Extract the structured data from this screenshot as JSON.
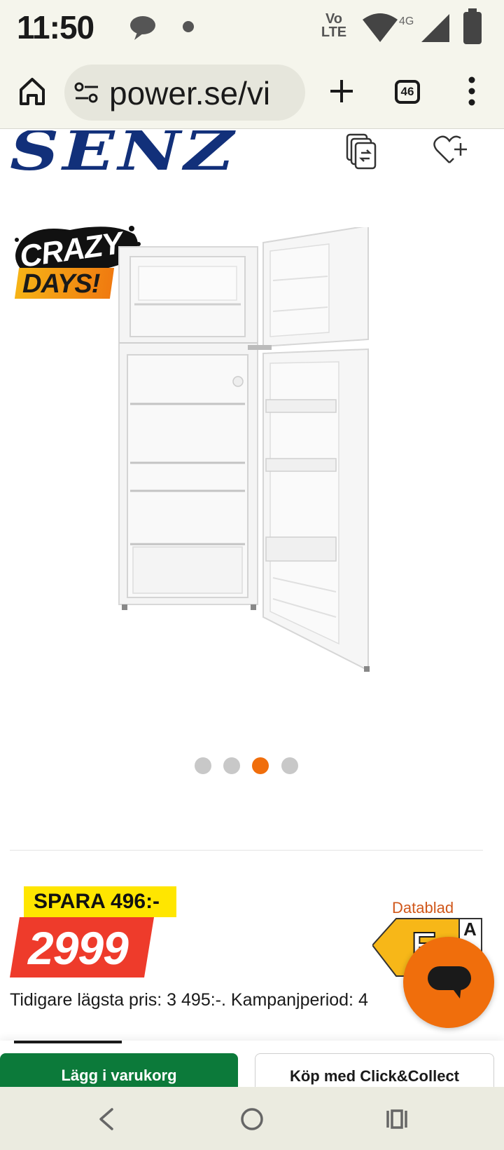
{
  "status_bar": {
    "time": "11:50",
    "network_label_top": "Vo",
    "network_label_bottom": "LTE",
    "signal_type": "4G",
    "icons": [
      "chat-bubble-icon",
      "dot-icon",
      "volte-icon",
      "wifi-icon",
      "signal-icon",
      "battery-icon"
    ]
  },
  "browser": {
    "url": "power.se/vi",
    "tab_count": "46",
    "icons": [
      "home-icon",
      "site-settings-icon",
      "new-tab-icon",
      "tabs-icon",
      "more-icon"
    ]
  },
  "page": {
    "brand": "SENZ",
    "promo_badge": {
      "line1": "CRAZY",
      "line2": "DAYS!"
    },
    "carousel": {
      "total": 4,
      "active_index": 2
    },
    "save_label": "SPARA 496:-",
    "price": "2999",
    "datablad_label": "Datablad",
    "energy_class": "E",
    "energy_scale_top": "A",
    "previous_price_text": "Tidigare lägsta pris: 3 495:-. Kampanjperiod: 4",
    "add_to_cart_label": "Lägg i varukorg",
    "click_collect_label": "Köp med Click&Collect"
  },
  "colors": {
    "brand_blue": "#12307a",
    "accent_orange": "#f06e0c",
    "price_red": "#ee3b2b",
    "save_yellow": "#ffe600",
    "cart_green": "#0c7a3a",
    "energy_yellow": "#f7b718"
  },
  "nav_bar": {
    "icons": [
      "back-icon",
      "home-circle-icon",
      "recents-icon"
    ]
  }
}
